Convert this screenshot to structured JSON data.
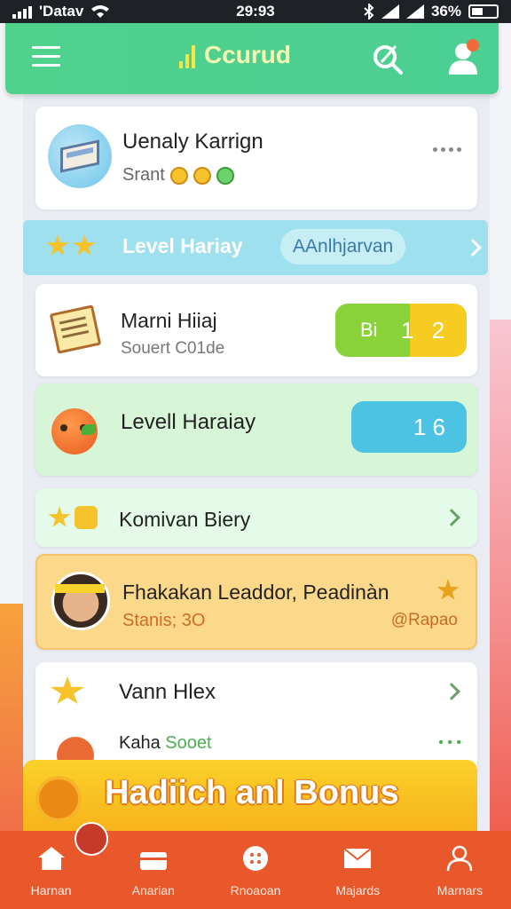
{
  "status_bar": {
    "carrier": "'Datav",
    "time": "29:93",
    "battery": "36%"
  },
  "header": {
    "title": "Ccurud"
  },
  "profile": {
    "name": "Uenaly Karrign",
    "sub": "Srant"
  },
  "level_banner": {
    "title": "Level Hariay",
    "pill": "AAnlhjarvan"
  },
  "task1": {
    "title": "Marni Hiiaj",
    "sub": "Souert C01de",
    "score_left": "Bi",
    "score_mid": "1",
    "score_right": "2"
  },
  "task2": {
    "title": "Levell Haraiay",
    "score": "1  6"
  },
  "bonus_row": {
    "title": "Komivan Biery"
  },
  "leader": {
    "title": "Fhakakan Leaddor, Peadinàn",
    "sub": "Stanis; 3O",
    "handle": "@Rapao"
  },
  "vann": {
    "title": "Vann Hlex",
    "sub_prefix": "Kaha",
    "sub_value": "Sooet",
    "dots": "•  • •"
  },
  "bonus_banner": {
    "text": "Hadiich anl Bonus"
  },
  "bottom_nav": {
    "items": [
      {
        "label": "Harnan",
        "icon": "home-icon"
      },
      {
        "label": "Anarian",
        "icon": "wallet-icon"
      },
      {
        "label": "Rnoaoan",
        "icon": "apps-icon"
      },
      {
        "label": "Majards",
        "icon": "mail-icon"
      },
      {
        "label": "Marnars",
        "icon": "user-icon"
      }
    ]
  },
  "colors": {
    "header": "#4fd28c",
    "nav": "#e8582a",
    "banner": "#fbd12a"
  }
}
